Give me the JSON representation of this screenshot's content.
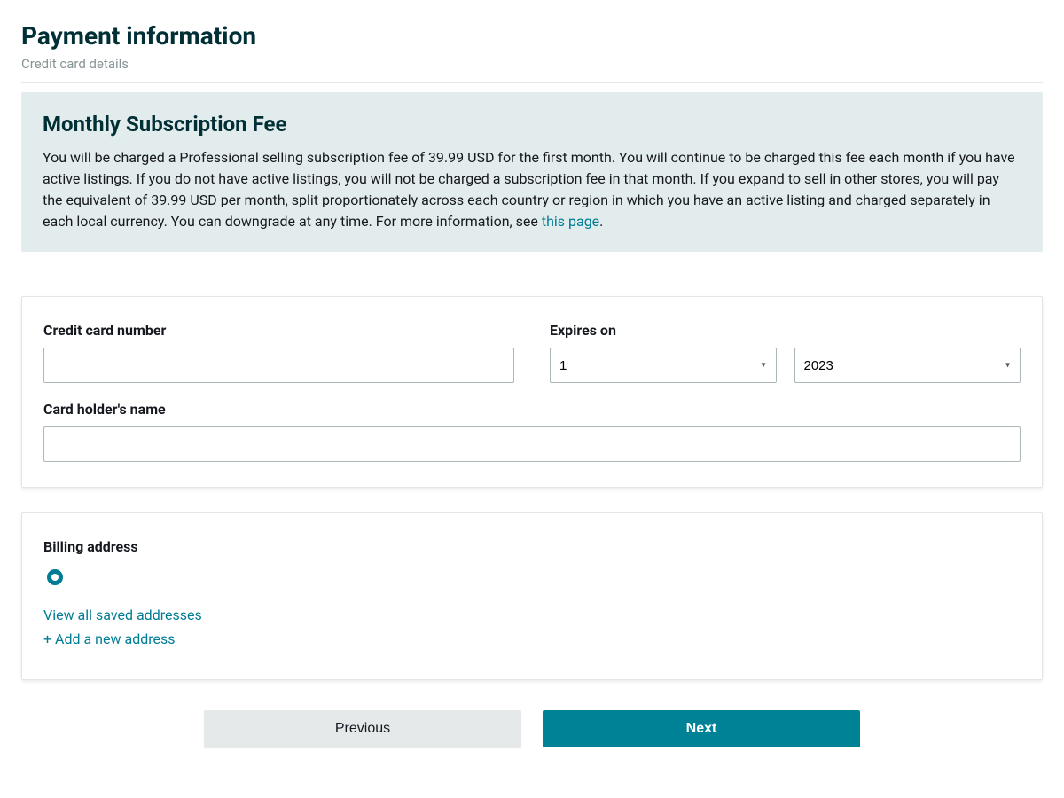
{
  "header": {
    "title": "Payment information",
    "subtitle": "Credit card details"
  },
  "info_box": {
    "title": "Monthly Subscription Fee",
    "body_before_link": "You will be charged a Professional selling subscription fee of 39.99 USD for the first month. You will continue to be charged this fee each month if you have active listings. If you do not have active listings, you will not be charged a subscription fee in that month. If you expand to sell in other stores, you will pay the equivalent of 39.99 USD per month, split proportionately across each country or region in which you have an active listing and charged separately in each local currency. You can downgrade at any time. For more information, see ",
    "link_text": "this page",
    "body_after_link": "."
  },
  "card_form": {
    "cc_number_label": "Credit card number",
    "cc_number_value": "",
    "expires_label": "Expires on",
    "expires_month": "1",
    "expires_year": "2023",
    "cardholder_label": "Card holder's name",
    "cardholder_value": ""
  },
  "billing": {
    "label": "Billing address",
    "view_all": "View all saved addresses",
    "add_new": "+ Add a new address"
  },
  "footer": {
    "previous": "Previous",
    "next": "Next"
  }
}
